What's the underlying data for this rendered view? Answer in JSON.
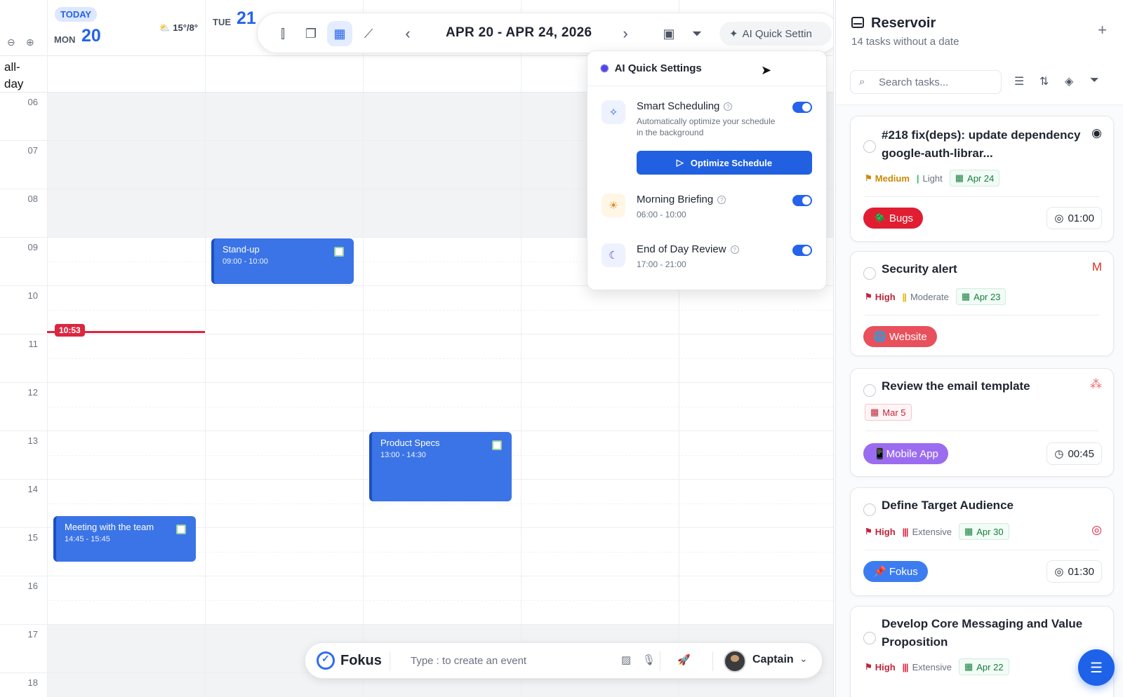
{
  "calendar": {
    "days": [
      {
        "today_label": "TODAY",
        "dow": "MON",
        "num": "20",
        "weather": "⛅ 15°/8°"
      },
      {
        "dow": "TUE",
        "num": "21"
      }
    ],
    "allday_label": "all-\nday",
    "hours": [
      "06",
      "07",
      "08",
      "09",
      "10",
      "11",
      "12",
      "13",
      "14",
      "15",
      "16",
      "17",
      "18"
    ],
    "now_time": "10:53",
    "events": [
      {
        "title": "Stand-up",
        "time": "09:00 - 10:00"
      },
      {
        "title": "Product Specs",
        "time": "13:00 - 14:30"
      },
      {
        "title": "Meeting with the team",
        "time": "14:45 - 15:45"
      }
    ]
  },
  "toolbar": {
    "date_range": "APR 20 - APR 24, 2026",
    "prev": "‹",
    "next": "›",
    "ai_label": "AI Quick Settin"
  },
  "ai_settings": {
    "title": "AI Quick Settings",
    "smart": {
      "title": "Smart Scheduling",
      "desc": "Automatically optimize your schedule in the background",
      "enabled": true
    },
    "optimize_label": "Optimize Schedule",
    "morning": {
      "title": "Morning Briefing",
      "time": "06:00 - 10:00",
      "enabled": true
    },
    "eod": {
      "title": "End of Day Review",
      "time": "17:00 - 21:00",
      "enabled": true
    }
  },
  "cmdbar": {
    "brand": "Fokus",
    "placeholder": "Type : to create an event",
    "user": "Captain"
  },
  "reservoir": {
    "title": "Reservoir",
    "subtitle": "14 tasks without a date",
    "search_placeholder": "Search tasks...",
    "tasks": [
      {
        "title": "#218 fix(deps): update dependency google-auth-librar...",
        "priority": "Medium",
        "effort": "Light",
        "date": "Apr 24",
        "tag": "🪲 Bugs",
        "duration": "01:00",
        "source": "github"
      },
      {
        "title": "Security alert",
        "priority": "High",
        "effort": "Moderate",
        "date": "Apr 23",
        "tag": "🌐 Website",
        "source": "gmail"
      },
      {
        "title": "Review the email template",
        "date": "Mar 5",
        "tag": "📱Mobile App",
        "duration": "00:45",
        "source": "asana"
      },
      {
        "title": "Define Target Audience",
        "priority": "High",
        "effort": "Extensive",
        "date": "Apr 30",
        "tag": "📌 Fokus",
        "duration": "01:30",
        "source": "target"
      },
      {
        "title": "Develop Core Messaging and Value Proposition",
        "priority": "High",
        "effort": "Extensive",
        "date": "Apr 22"
      }
    ]
  },
  "colors": {
    "accent": "#2563eb",
    "event": "#3b74e6",
    "now": "#dc2640",
    "bugs_tag": "#e11d32",
    "website_tag": "#e8505b",
    "mobile_tag": "#9b6cf0",
    "fokus_tag": "#3d7cf0"
  }
}
